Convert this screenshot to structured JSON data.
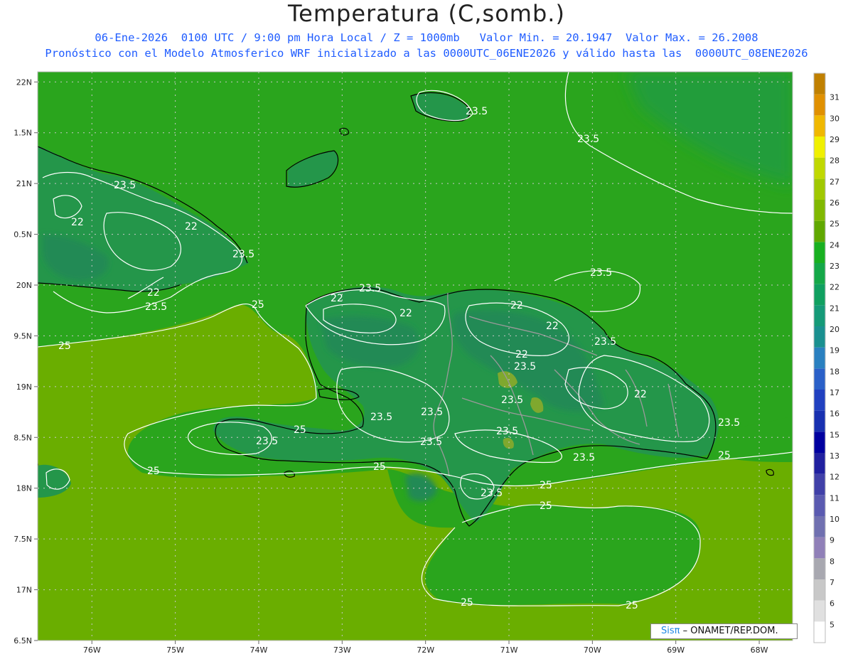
{
  "title": "Temperatura (C,somb.)",
  "subtitle_line1": "06-Ene-2026  0100 UTC / 9:00 pm Hora Local / Z = 1000mb   Valor Min. = 20.1947  Valor Max. = 26.2008",
  "subtitle_line2": "Pronóstico con el Modelo Atmosferico WRF inicializado a las 0000UTC_06ENE2026 y válido hasta las  0000UTC_08ENE2026",
  "credit": {
    "brand": "Sisπ",
    "text": " – ONAMET/REP.DOM."
  },
  "chart_data": {
    "type": "heatmap",
    "variable": "Temperatura (C,somb.)",
    "level": "1000mb",
    "valor_min": 20.1947,
    "valor_max": 26.2008,
    "x_ticks": [
      "76W",
      "75W",
      "74W",
      "73W",
      "72W",
      "71W",
      "70W",
      "69W",
      "68W"
    ],
    "y_ticks": [
      "22N",
      "1.5N",
      "21N",
      "0.5N",
      "20N",
      "9.5N",
      "19N",
      "8.5N",
      "18N",
      "7.5N",
      "17N",
      "6.5N"
    ],
    "xlim": [
      -76.65,
      -67.6
    ],
    "ylim": [
      16.5,
      22.1
    ],
    "colorbar": {
      "labels": [
        "5",
        "6",
        "7",
        "8",
        "9",
        "10",
        "11",
        "12",
        "13",
        "15",
        "16",
        "17",
        "18",
        "19",
        "20",
        "21",
        "22",
        "23",
        "24",
        "25",
        "26",
        "27",
        "28",
        "29",
        "30",
        "31"
      ],
      "colors": [
        "#ffffff",
        "#e0e0e0",
        "#c8c8c8",
        "#a8a8b0",
        "#9080b8",
        "#7070b0",
        "#5a5ab0",
        "#4040a8",
        "#2020a0",
        "#0000a0",
        "#1830b0",
        "#2040c0",
        "#2a60c8",
        "#2a80c0",
        "#1a9090",
        "#159a78",
        "#10a060",
        "#14a848",
        "#18b020",
        "#60a800",
        "#80b800",
        "#a0c800",
        "#c0d800",
        "#f0f000",
        "#f0b800",
        "#e09000",
        "#c08000"
      ]
    },
    "contour_labels": [
      "22",
      "23.5",
      "25"
    ],
    "contour_levels": [
      22,
      23.5,
      25
    ],
    "land_regions": [
      "Cuba oriental",
      "Hispaniola",
      "Islas Turcas y Caicos",
      "Inagua",
      "Jamaica"
    ]
  },
  "colors": {
    "ocean_warm": "#6aae00",
    "ocean_cool": "#2aa51d",
    "land": "#24964a",
    "land_cool": "#208a55",
    "contour": "#ffffff",
    "coast": "#000000",
    "border": "#9a9a9a",
    "subtitle": "#1f5cff"
  }
}
